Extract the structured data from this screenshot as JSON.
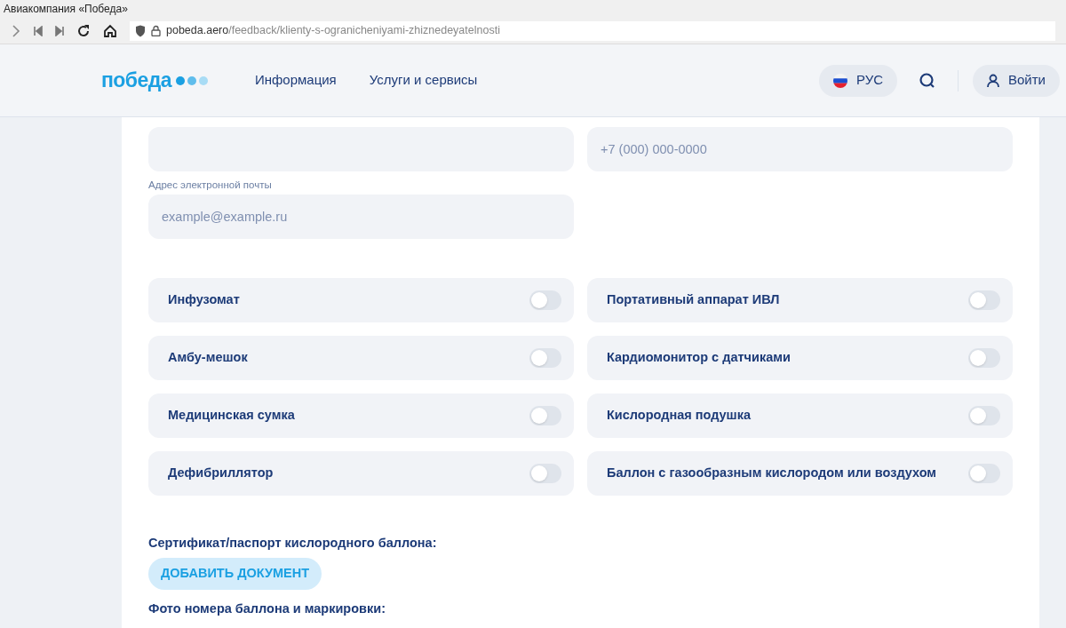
{
  "browser": {
    "title": "Авиакомпания «Победа»",
    "url_host": "pobeda.aero",
    "url_path": "/feedback/klienty-s-ogranicheniyami-zhiznedeyatelnosti"
  },
  "header": {
    "logo": "победа",
    "nav": [
      "Информация",
      "Услуги и сервисы"
    ],
    "language": "РУС",
    "login": "Войти"
  },
  "fields": [
    {
      "kind": "input"
    },
    {
      "kind": "input",
      "placeholder": "+7 (000) 000-0000"
    },
    {
      "kind": "input",
      "label": "Адрес электронной почты",
      "placeholder": "example@example.ru"
    }
  ],
  "toggles": [
    {
      "label": "Инфузомат",
      "on": false
    },
    {
      "label": "Портативный аппарат ИВЛ",
      "on": false
    },
    {
      "label": "Амбу-мешок",
      "on": false
    },
    {
      "label": "Кардиомонитор с датчиками",
      "on": false
    },
    {
      "label": "Медицинская сумка",
      "on": false
    },
    {
      "label": "Кислородная подушка",
      "on": false
    },
    {
      "label": "Дефибриллятор",
      "on": false
    },
    {
      "label": "Баллон с газообразным кислородом или воздухом",
      "on": false
    }
  ],
  "documents": [
    {
      "heading": "Сертификат/паспорт кислородного баллона:",
      "button": "ДОБАВИТЬ ДОКУМЕНТ"
    },
    {
      "heading": "Фото номера баллона и маркировки:"
    }
  ]
}
